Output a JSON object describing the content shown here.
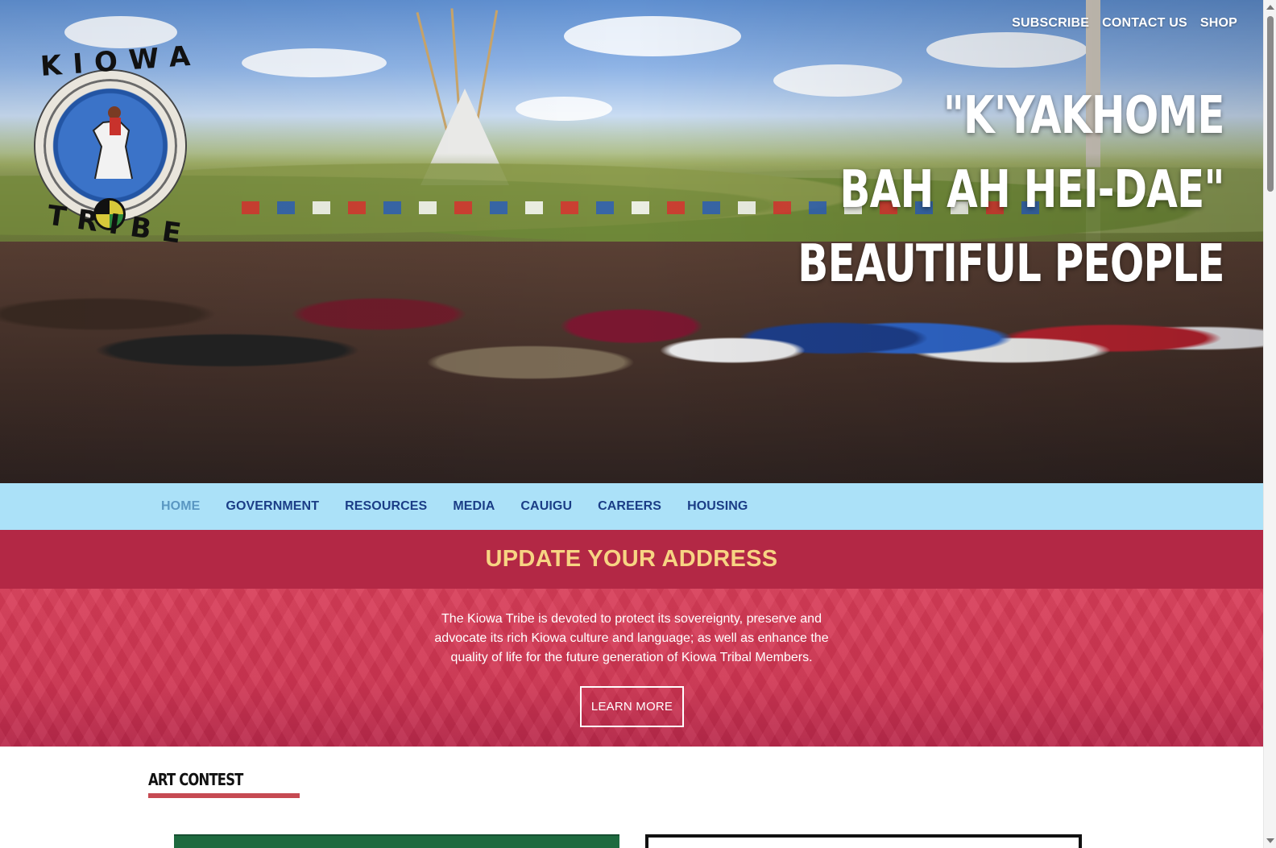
{
  "header": {
    "top_links": [
      "SUBSCRIBE",
      "CONTACT US",
      "SHOP"
    ],
    "logo": {
      "top_text": "KIOWA",
      "bottom_text": "TRIBE"
    },
    "hero_title_lines": [
      "\"K'YAKHOME",
      "BAH AH HEI-DAE\"",
      "BEAUTIFUL PEOPLE"
    ]
  },
  "nav": {
    "items": [
      "HOME",
      "GOVERNMENT",
      "RESOURCES",
      "MEDIA",
      "CAUIGU",
      "CAREERS",
      "HOUSING"
    ],
    "active": "HOME"
  },
  "banner": {
    "heading": "UPDATE YOUR ADDRESS",
    "mission": "The Kiowa Tribe is devoted to protect its sovereignty, preserve and advocate its rich Kiowa culture and language; as well as enhance the quality of life for the future generation of Kiowa Tribal Members.",
    "button_label": "LEARN MORE"
  },
  "section": {
    "title": "ART CONTEST"
  },
  "colors": {
    "nav_bg": "#abe1f8",
    "nav_text": "#1b3d86",
    "nav_active": "#5a97c2",
    "banner_head_bg": "#b32845",
    "banner_head_text": "#f7d483",
    "banner_body_bg": "#d83d58",
    "section_underline": "#c64a52"
  },
  "icons": [
    "kiowa-tribe-logo",
    "scroll-up-arrow",
    "scroll-down-arrow"
  ]
}
